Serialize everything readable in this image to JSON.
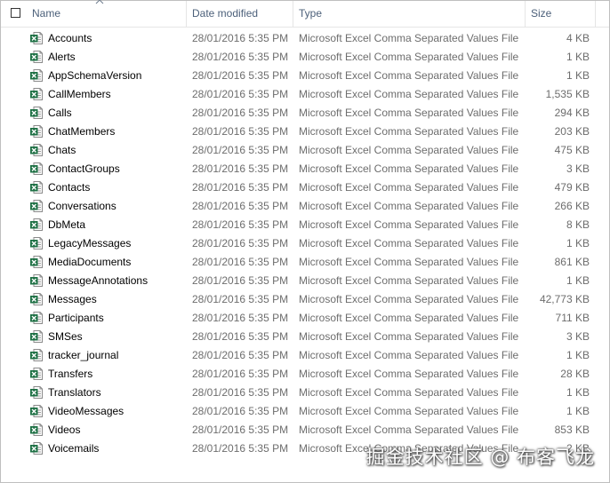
{
  "header": {
    "name": "Name",
    "date_modified": "Date modified",
    "type": "Type",
    "size": "Size"
  },
  "files": [
    {
      "name": "Accounts",
      "date": "28/01/2016 5:35 PM",
      "type": "Microsoft Excel Comma Separated Values File",
      "size": "4 KB"
    },
    {
      "name": "Alerts",
      "date": "28/01/2016 5:35 PM",
      "type": "Microsoft Excel Comma Separated Values File",
      "size": "1 KB"
    },
    {
      "name": "AppSchemaVersion",
      "date": "28/01/2016 5:35 PM",
      "type": "Microsoft Excel Comma Separated Values File",
      "size": "1 KB"
    },
    {
      "name": "CallMembers",
      "date": "28/01/2016 5:35 PM",
      "type": "Microsoft Excel Comma Separated Values File",
      "size": "1,535 KB"
    },
    {
      "name": "Calls",
      "date": "28/01/2016 5:35 PM",
      "type": "Microsoft Excel Comma Separated Values File",
      "size": "294 KB"
    },
    {
      "name": "ChatMembers",
      "date": "28/01/2016 5:35 PM",
      "type": "Microsoft Excel Comma Separated Values File",
      "size": "203 KB"
    },
    {
      "name": "Chats",
      "date": "28/01/2016 5:35 PM",
      "type": "Microsoft Excel Comma Separated Values File",
      "size": "475 KB"
    },
    {
      "name": "ContactGroups",
      "date": "28/01/2016 5:35 PM",
      "type": "Microsoft Excel Comma Separated Values File",
      "size": "3 KB"
    },
    {
      "name": "Contacts",
      "date": "28/01/2016 5:35 PM",
      "type": "Microsoft Excel Comma Separated Values File",
      "size": "479 KB"
    },
    {
      "name": "Conversations",
      "date": "28/01/2016 5:35 PM",
      "type": "Microsoft Excel Comma Separated Values File",
      "size": "266 KB"
    },
    {
      "name": "DbMeta",
      "date": "28/01/2016 5:35 PM",
      "type": "Microsoft Excel Comma Separated Values File",
      "size": "8 KB"
    },
    {
      "name": "LegacyMessages",
      "date": "28/01/2016 5:35 PM",
      "type": "Microsoft Excel Comma Separated Values File",
      "size": "1 KB"
    },
    {
      "name": "MediaDocuments",
      "date": "28/01/2016 5:35 PM",
      "type": "Microsoft Excel Comma Separated Values File",
      "size": "861 KB"
    },
    {
      "name": "MessageAnnotations",
      "date": "28/01/2016 5:35 PM",
      "type": "Microsoft Excel Comma Separated Values File",
      "size": "1 KB"
    },
    {
      "name": "Messages",
      "date": "28/01/2016 5:35 PM",
      "type": "Microsoft Excel Comma Separated Values File",
      "size": "42,773 KB"
    },
    {
      "name": "Participants",
      "date": "28/01/2016 5:35 PM",
      "type": "Microsoft Excel Comma Separated Values File",
      "size": "711 KB"
    },
    {
      "name": "SMSes",
      "date": "28/01/2016 5:35 PM",
      "type": "Microsoft Excel Comma Separated Values File",
      "size": "3 KB"
    },
    {
      "name": "tracker_journal",
      "date": "28/01/2016 5:35 PM",
      "type": "Microsoft Excel Comma Separated Values File",
      "size": "1 KB"
    },
    {
      "name": "Transfers",
      "date": "28/01/2016 5:35 PM",
      "type": "Microsoft Excel Comma Separated Values File",
      "size": "28 KB"
    },
    {
      "name": "Translators",
      "date": "28/01/2016 5:35 PM",
      "type": "Microsoft Excel Comma Separated Values File",
      "size": "1 KB"
    },
    {
      "name": "VideoMessages",
      "date": "28/01/2016 5:35 PM",
      "type": "Microsoft Excel Comma Separated Values File",
      "size": "1 KB"
    },
    {
      "name": "Videos",
      "date": "28/01/2016 5:35 PM",
      "type": "Microsoft Excel Comma Separated Values File",
      "size": "853 KB"
    },
    {
      "name": "Voicemails",
      "date": "28/01/2016 5:35 PM",
      "type": "Microsoft Excel Comma Separated Values File",
      "size": "2 KB"
    }
  ],
  "file_icon": "excel-csv-file-icon",
  "colors": {
    "header_text": "#4c607a",
    "detail_text": "#6d6d6d",
    "excel_green": "#1e7145"
  },
  "watermark": "掘金技术社区 @ 布客飞龙"
}
